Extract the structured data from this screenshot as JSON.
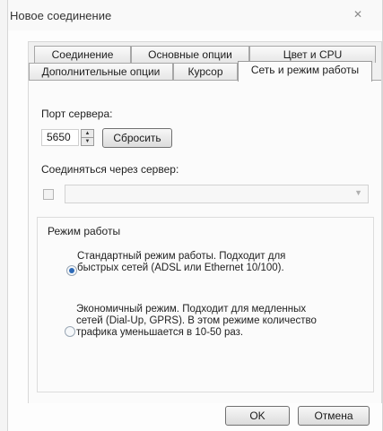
{
  "window": {
    "title": "Новое соединение",
    "close_glyph": "✕"
  },
  "tabs": {
    "row1": [
      "Соединение",
      "Основные опции",
      "Цвет и CPU"
    ],
    "row2": [
      "Дополнительные опции",
      "Курсор",
      "Сеть и режим работы"
    ]
  },
  "network": {
    "port_label": "Порт сервера:",
    "port_value": "5650",
    "reset_label": "Сбросить",
    "via_server_label": "Соединяться через сервер:",
    "via_server_checked": false,
    "server_combo_value": ""
  },
  "mode": {
    "group_label": "Режим работы",
    "standard_text": "Стандартный режим работы. Подходит для\nбыстрых сетей (ADSL или Ethernet 10/100).",
    "economy_text": "Экономичный режим. Подходит для медленных\nсетей (Dial-Up, GPRS). В этом режиме количество\nтрафика уменьшается в 10-50 раз.",
    "selected": "standard"
  },
  "buttons": {
    "ok": "OK",
    "cancel": "Отмена"
  },
  "icons": {
    "spin_up": "up-arrow-icon",
    "spin_down": "down-arrow-icon",
    "combo_arrow": "chevron-down-icon"
  }
}
